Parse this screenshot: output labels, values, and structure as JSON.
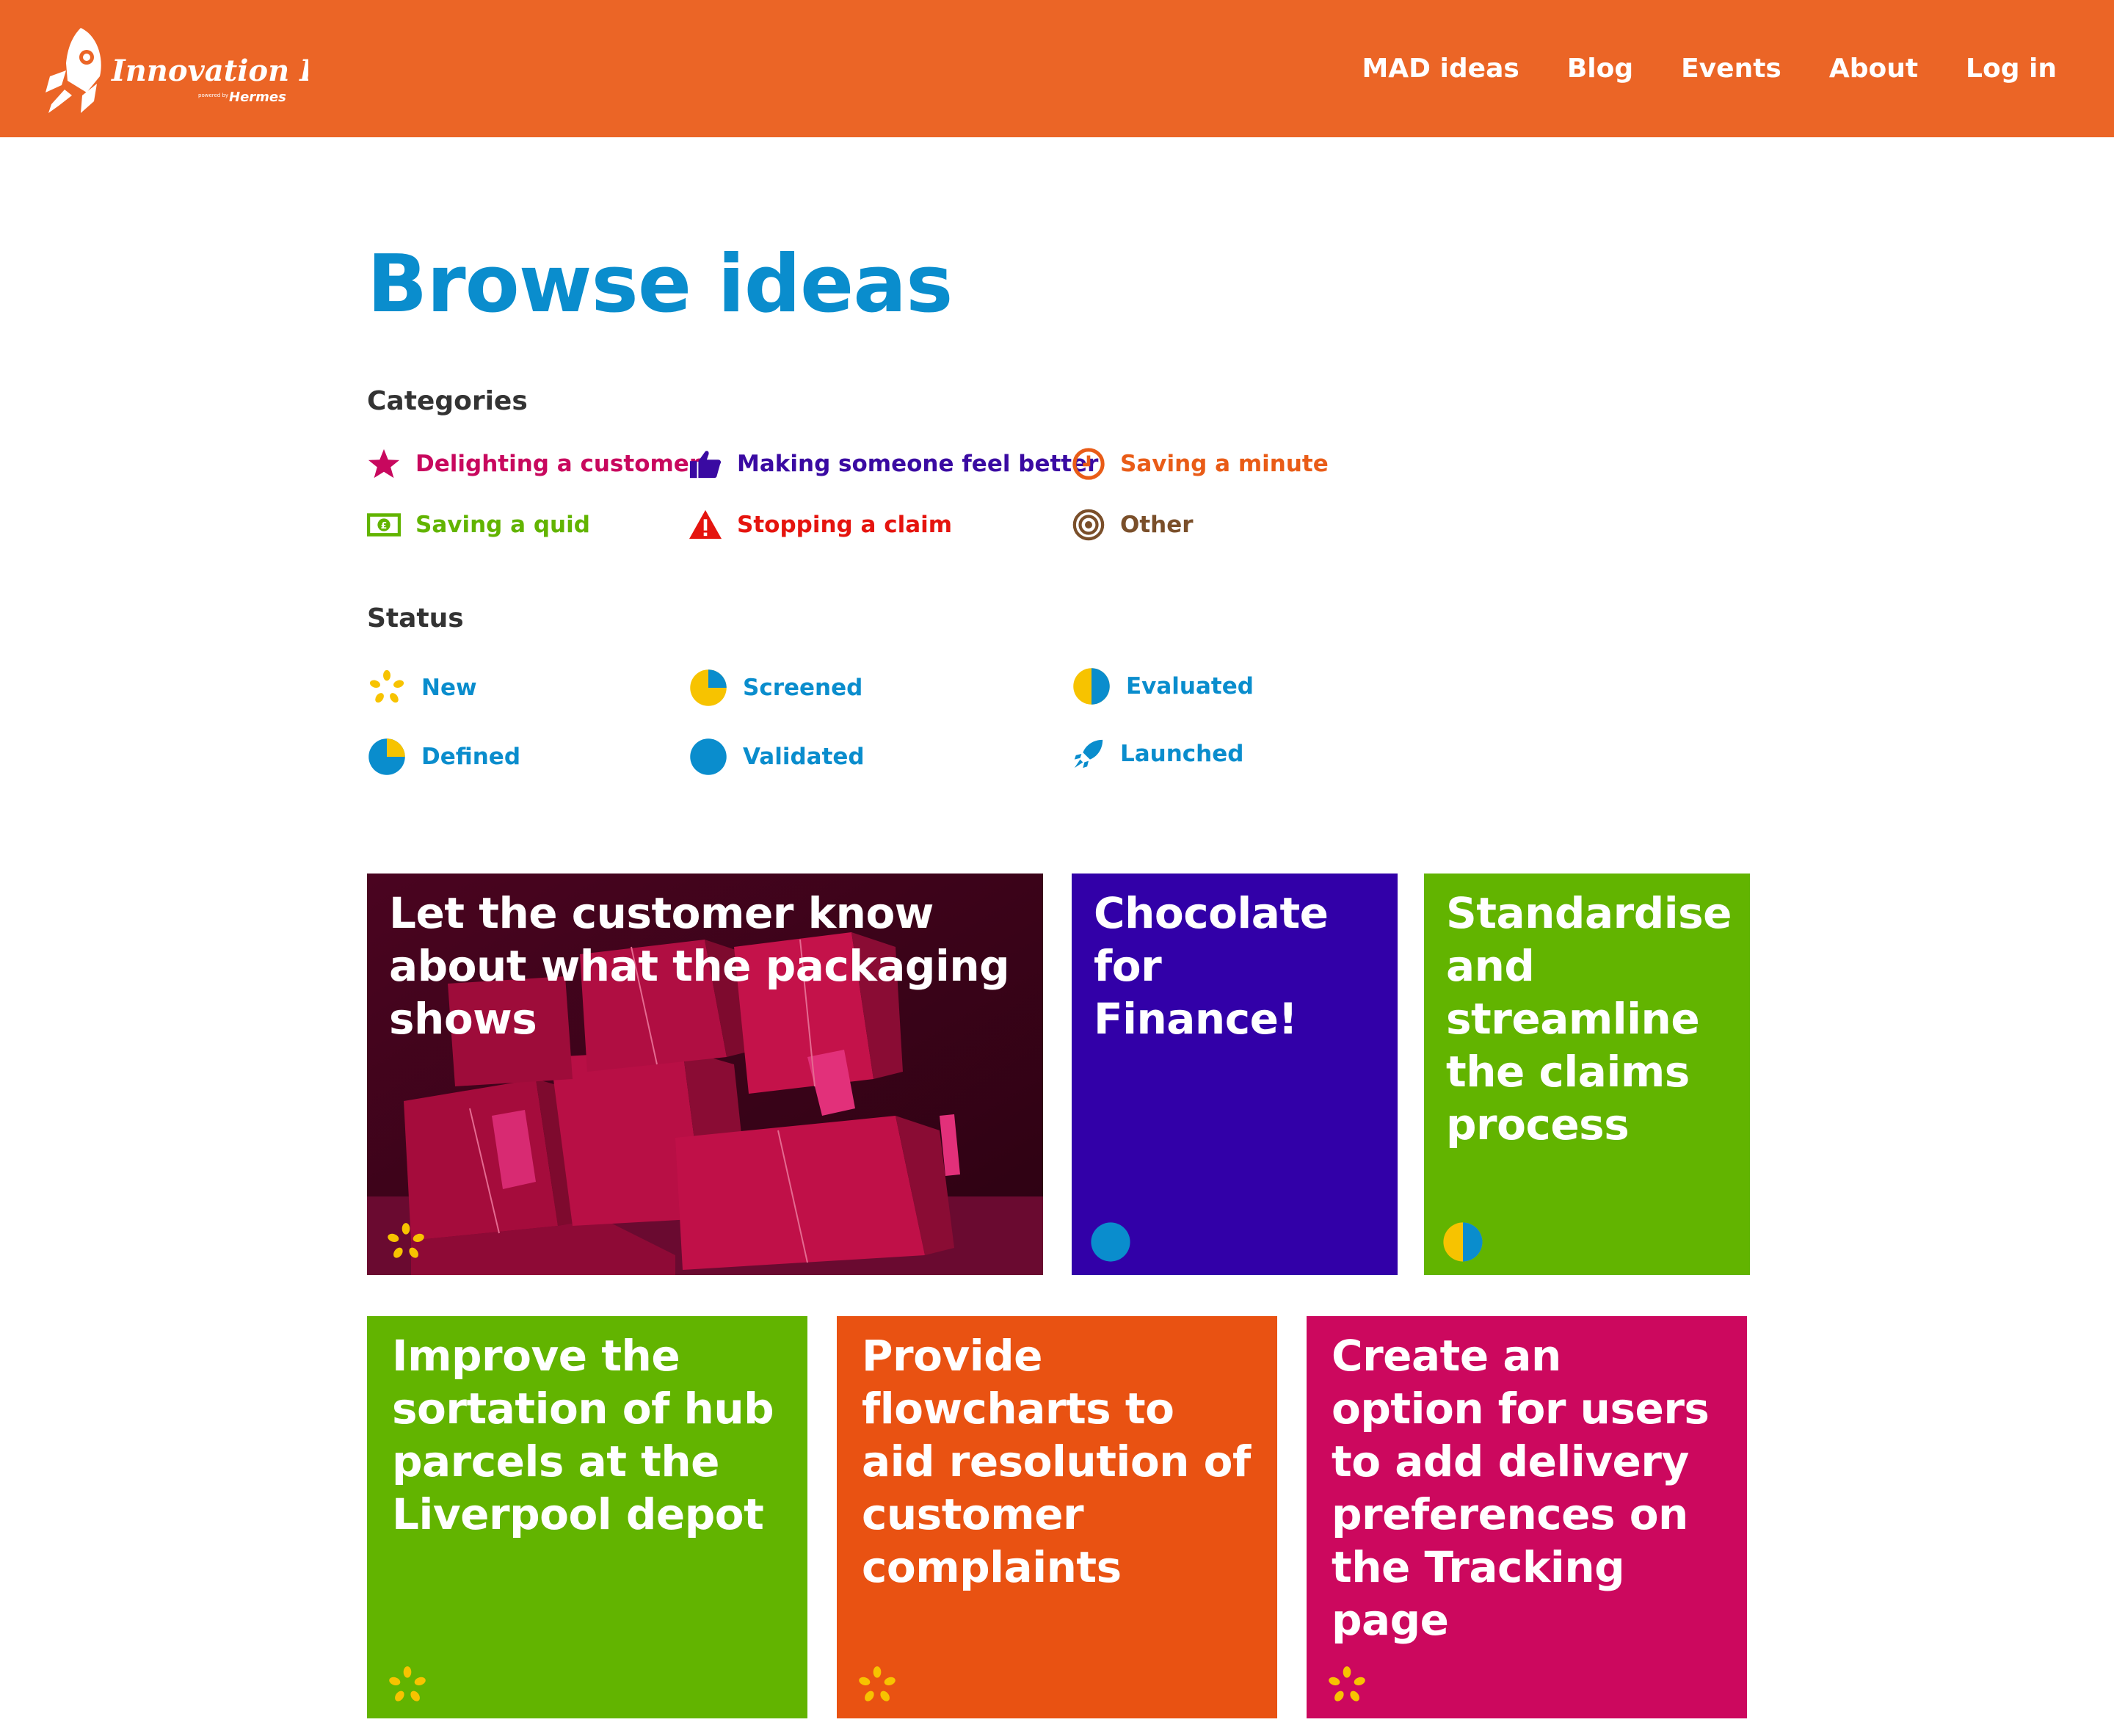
{
  "header": {
    "brand": "Innovation Lab",
    "brand_sub": "powered by",
    "brand_company": "Hermes",
    "nav": [
      "MAD ideas",
      "Blog",
      "Events",
      "About",
      "Log in"
    ]
  },
  "page_title": "Browse ideas",
  "categories": {
    "label": "Categories",
    "items": [
      {
        "label": "Delighting a customer",
        "icon": "star-icon",
        "color": "#c8085e"
      },
      {
        "label": "Making someone feel better",
        "icon": "thumbs-up-icon",
        "color": "#3a0aa2"
      },
      {
        "label": "Saving a minute",
        "icon": "clock-icon",
        "color": "#e95c17"
      },
      {
        "label": "Saving a quid",
        "icon": "banknote-icon",
        "color": "#62b400"
      },
      {
        "label": "Stopping a claim",
        "icon": "warning-icon",
        "color": "#e5140e"
      },
      {
        "label": "Other",
        "icon": "target-icon",
        "color": "#7a4f2a"
      }
    ]
  },
  "status": {
    "label": "Status",
    "items": [
      {
        "label": "New",
        "icon": "sparkle-icon"
      },
      {
        "label": "Screened",
        "icon": "pie-quarter-icon"
      },
      {
        "label": "Evaluated",
        "icon": "pie-half-icon"
      },
      {
        "label": "Defined",
        "icon": "pie-three-quarter-icon"
      },
      {
        "label": "Validated",
        "icon": "pie-full-icon"
      },
      {
        "label": "Launched",
        "icon": "rocket-icon"
      }
    ],
    "color": "#0a8dcd"
  },
  "ideas": [
    {
      "title": "Let the customer know about what the packaging shows",
      "status": "New",
      "color": "#5a0a2a"
    },
    {
      "title": "Chocolate for Finance!",
      "status": "Validated",
      "color": "#3200a8"
    },
    {
      "title": "Standardise and streamline the claims process",
      "status": "Evaluated",
      "color": "#62b400"
    },
    {
      "title": "Improve the sortation of hub parcels at the Liverpool depot",
      "status": "New",
      "color": "#62b400"
    },
    {
      "title": "Provide flowcharts to aid resolution of customer complaints",
      "status": "New",
      "color": "#e95212"
    },
    {
      "title": "Create an option for users to add delivery preferences on the Tracking page",
      "status": "New",
      "color": "#cc085e"
    }
  ]
}
